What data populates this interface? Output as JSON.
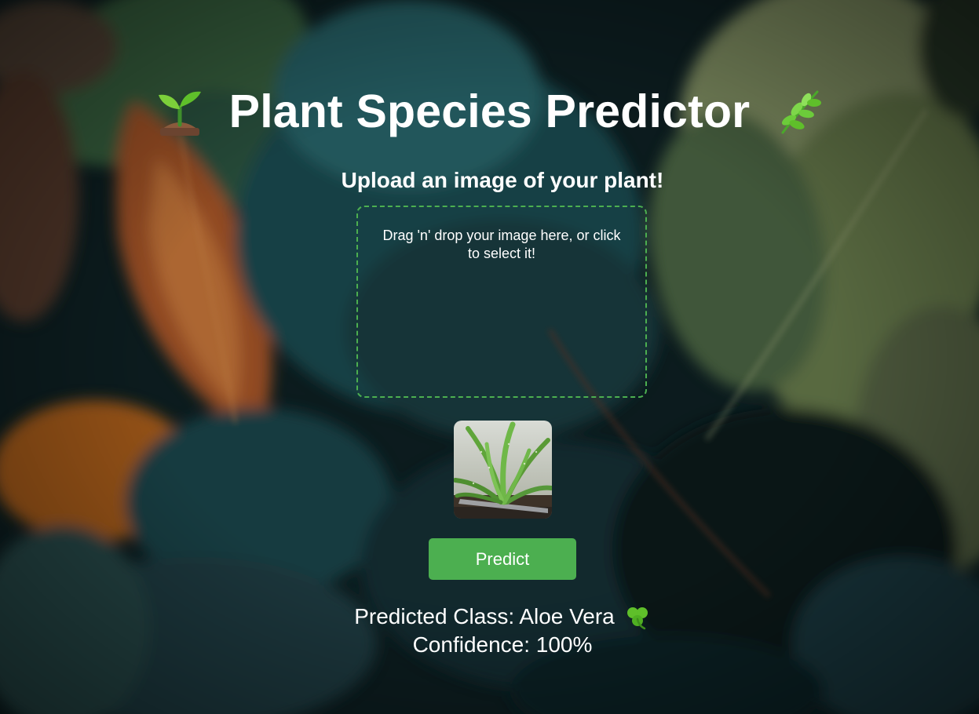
{
  "header": {
    "title": "Plant Species Predictor",
    "left_icon": "seedling-icon",
    "right_icon": "herb-icon"
  },
  "upload": {
    "heading": "Upload an image of your plant!",
    "dropzone_text": "Drag 'n' drop your image here, or click to select it!"
  },
  "preview": {
    "image": "aloe-vera-photo"
  },
  "actions": {
    "predict_label": "Predict"
  },
  "result": {
    "class_text": "Predicted Class: Aloe Vera",
    "class_icon": "shamrock-icon",
    "confidence_text": "Confidence: 100%"
  },
  "colors": {
    "accent": "#4caf50",
    "text": "#ffffff",
    "background": "#0f1f22"
  }
}
